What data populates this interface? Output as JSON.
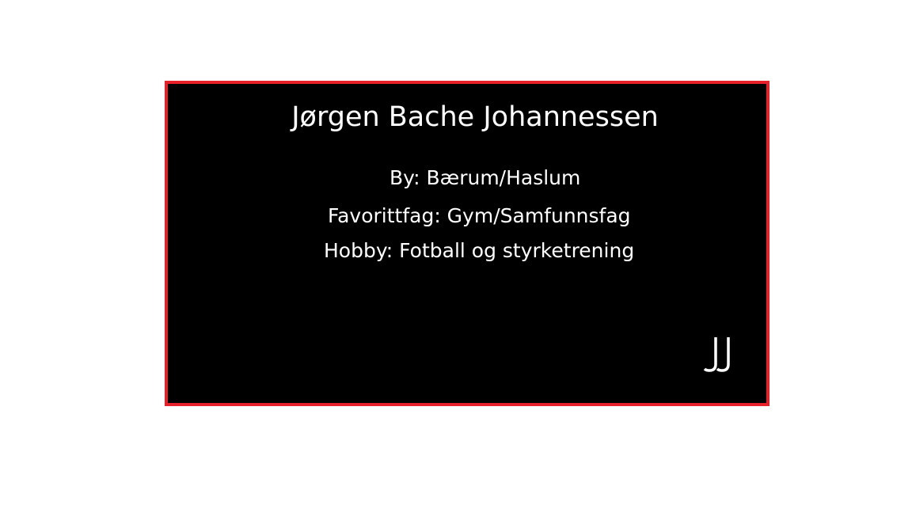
{
  "card": {
    "name": "Jørgen Bache Johannessen",
    "city": "By: Bærum/Haslum",
    "favorite_subject": "Favorittfag: Gym/Samfunnsfag",
    "hobby": "Hobby: Fotball og styrketrening",
    "logo_text": "JJ",
    "logo_icon": "jj-monogram-icon"
  },
  "colors": {
    "card_background": "#000000",
    "card_border": "#e8202a",
    "text": "#ffffff",
    "page_background": "#ffffff"
  }
}
